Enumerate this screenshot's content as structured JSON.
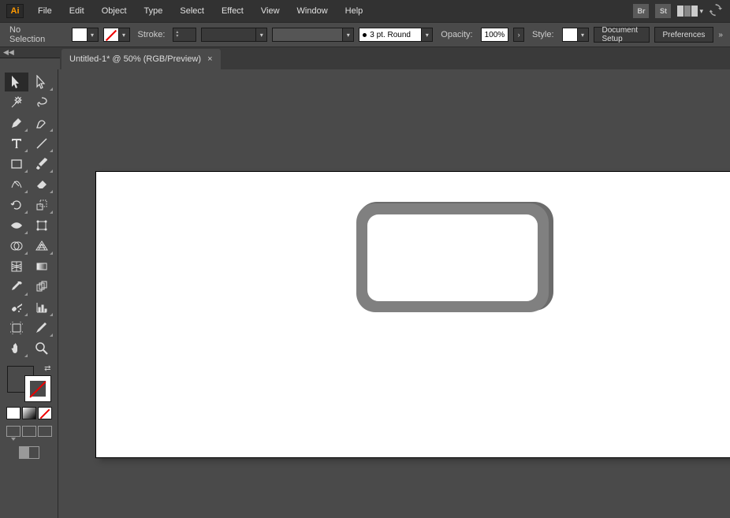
{
  "app": {
    "logo_text": "Ai"
  },
  "menu": {
    "items": [
      "File",
      "Edit",
      "Object",
      "Type",
      "Select",
      "Effect",
      "View",
      "Window",
      "Help"
    ]
  },
  "menubar_right": {
    "br_label": "Br",
    "st_label": "St"
  },
  "controlbar": {
    "selection_label": "No Selection",
    "stroke_label": "Stroke:",
    "brush_preset_label": "3 pt. Round",
    "opacity_label": "Opacity:",
    "opacity_value": "100%",
    "style_label": "Style:",
    "doc_setup_label": "Document Setup",
    "preferences_label": "Preferences"
  },
  "tab": {
    "title": "Untitled-1* @ 50% (RGB/Preview)",
    "close": "×"
  },
  "collapse_strip": {
    "chev": "◀◀"
  },
  "tools": {
    "names": [
      [
        "selection-tool",
        "direct-selection-tool"
      ],
      [
        "magic-wand-tool",
        "lasso-tool"
      ],
      [
        "pen-tool",
        "curvature-tool"
      ],
      [
        "type-tool",
        "line-segment-tool"
      ],
      [
        "rectangle-tool",
        "paintbrush-tool"
      ],
      [
        "shaper-tool",
        "eraser-tool"
      ],
      [
        "rotate-tool",
        "scale-tool"
      ],
      [
        "width-tool",
        "free-transform-tool"
      ],
      [
        "shape-builder-tool",
        "perspective-grid-tool"
      ],
      [
        "mesh-tool",
        "gradient-tool"
      ],
      [
        "eyedropper-tool",
        "blend-tool"
      ],
      [
        "symbol-sprayer-tool",
        "column-graph-tool"
      ],
      [
        "artboard-tool",
        "slice-tool"
      ],
      [
        "hand-tool",
        "zoom-tool"
      ]
    ]
  }
}
